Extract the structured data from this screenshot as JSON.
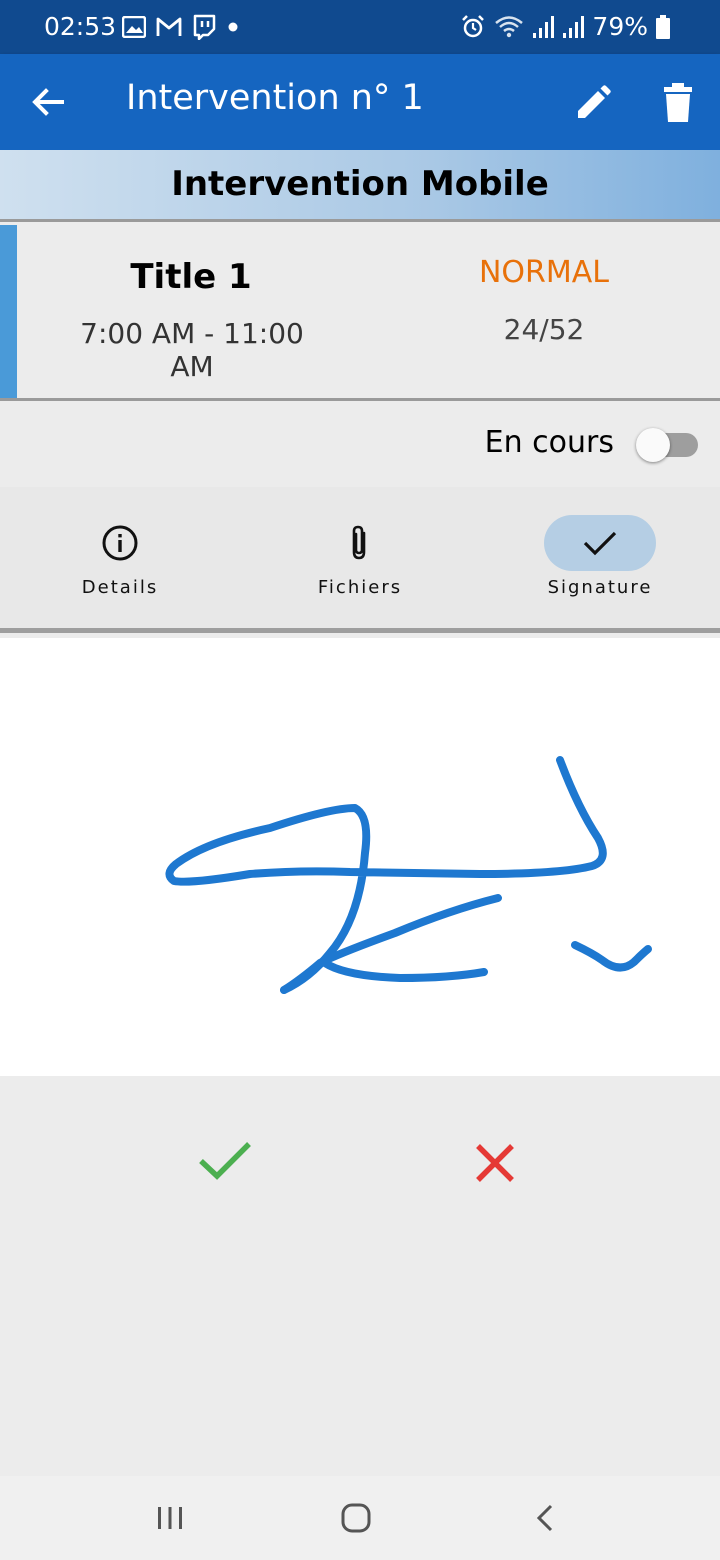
{
  "status_bar": {
    "time": "02:53",
    "battery": "79%",
    "left_icons": [
      "gallery-icon",
      "gmail-icon",
      "twitch-icon",
      "dot-icon"
    ],
    "right_icons": [
      "alarm-icon",
      "wifi-icon",
      "signal-icon",
      "signal-icon",
      "battery-icon"
    ]
  },
  "app_bar": {
    "title": "Intervention n° 1",
    "icons": [
      "back-arrow-icon",
      "edit-pencil-icon",
      "delete-trash-icon"
    ]
  },
  "banner": {
    "text": "Intervention Mobile"
  },
  "intervention": {
    "title": "Title 1",
    "hours": "7:00 AM - 11:00 AM",
    "priority": "NORMAL",
    "progress": "24/52"
  },
  "status_toggle": {
    "label": "En cours",
    "on": false
  },
  "tabs": [
    {
      "label": "Details",
      "icon": "info-icon",
      "active": false
    },
    {
      "label": "Fichiers",
      "icon": "paperclip-icon",
      "active": false
    },
    {
      "label": "Signature",
      "icon": "check-icon",
      "active": true
    }
  ],
  "signature_actions": {
    "icons": [
      "confirm-check-icon",
      "cancel-x-icon"
    ]
  },
  "nav_bar": {
    "icons": [
      "recent-apps-icon",
      "home-icon",
      "back-icon"
    ]
  },
  "colors": {
    "status_bar": "#104a8f",
    "app_bar": "#1565c0",
    "priority": "#e8710a",
    "signature_ink": "#1e78d0",
    "confirm": "#4caf50",
    "cancel": "#e53935",
    "active_tab": "#b5cee4",
    "accent_bar": "#4a9ad8"
  }
}
